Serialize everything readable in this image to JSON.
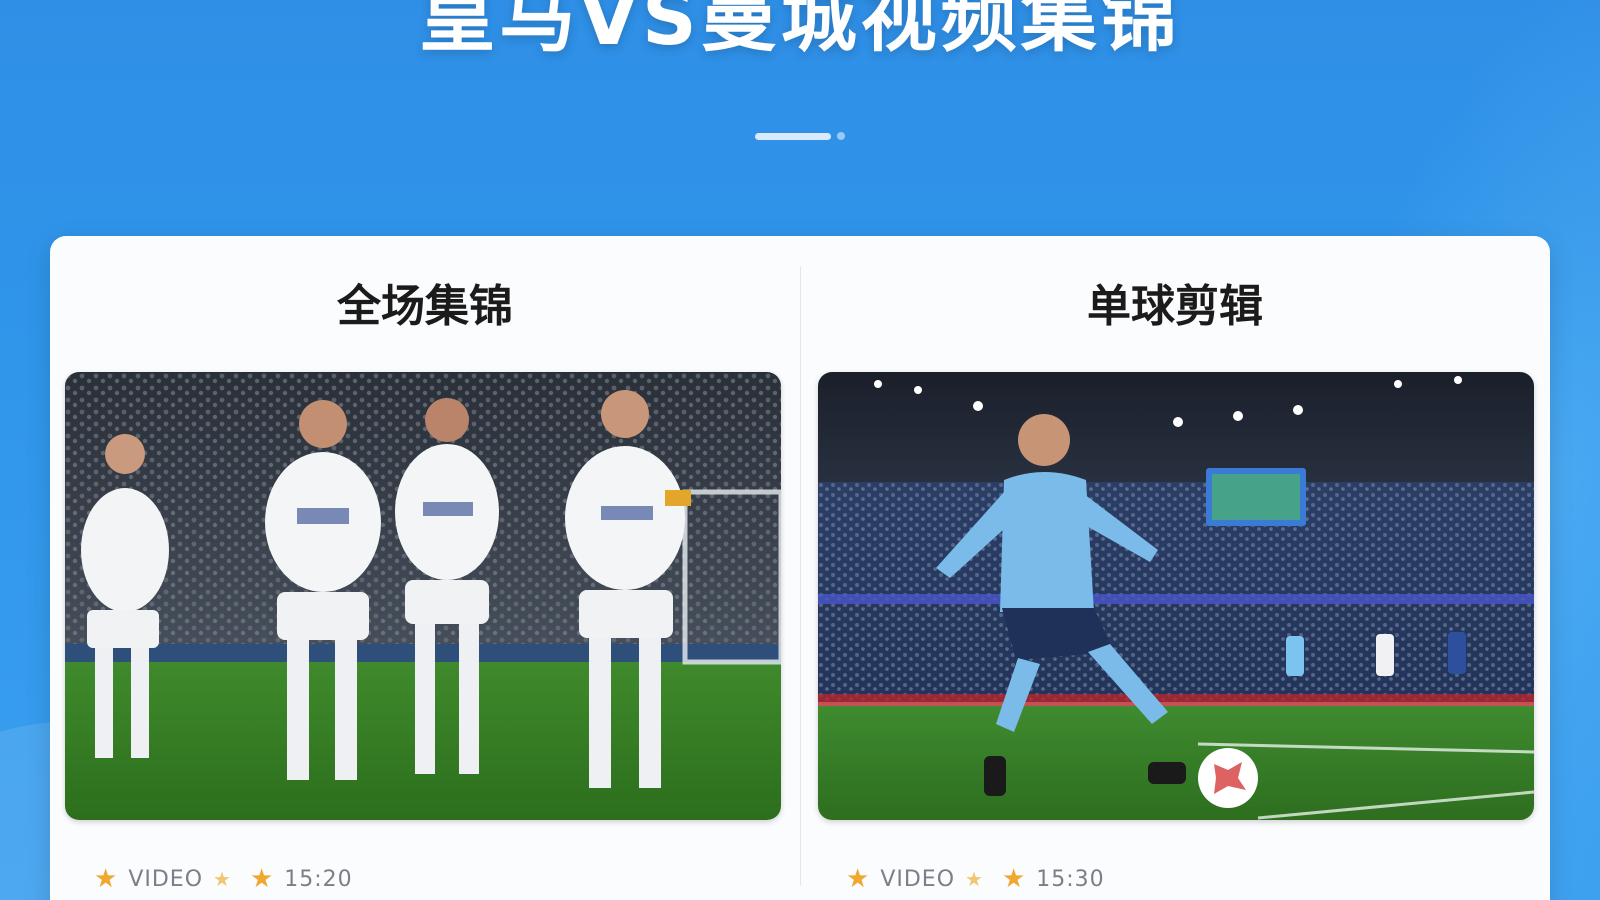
{
  "page": {
    "title": "皇马VS曼城视频集锦"
  },
  "cards": [
    {
      "title": "全场集锦",
      "meta_type": "VIDEO",
      "meta_duration": "15:20"
    },
    {
      "title": "单球剪辑",
      "meta_type": "VIDEO",
      "meta_duration": "15:30"
    }
  ],
  "icons": {
    "star": "star-icon"
  },
  "colors": {
    "background": "#2f96ea",
    "panel": "#fbfcfe",
    "star": "#f0a830"
  }
}
